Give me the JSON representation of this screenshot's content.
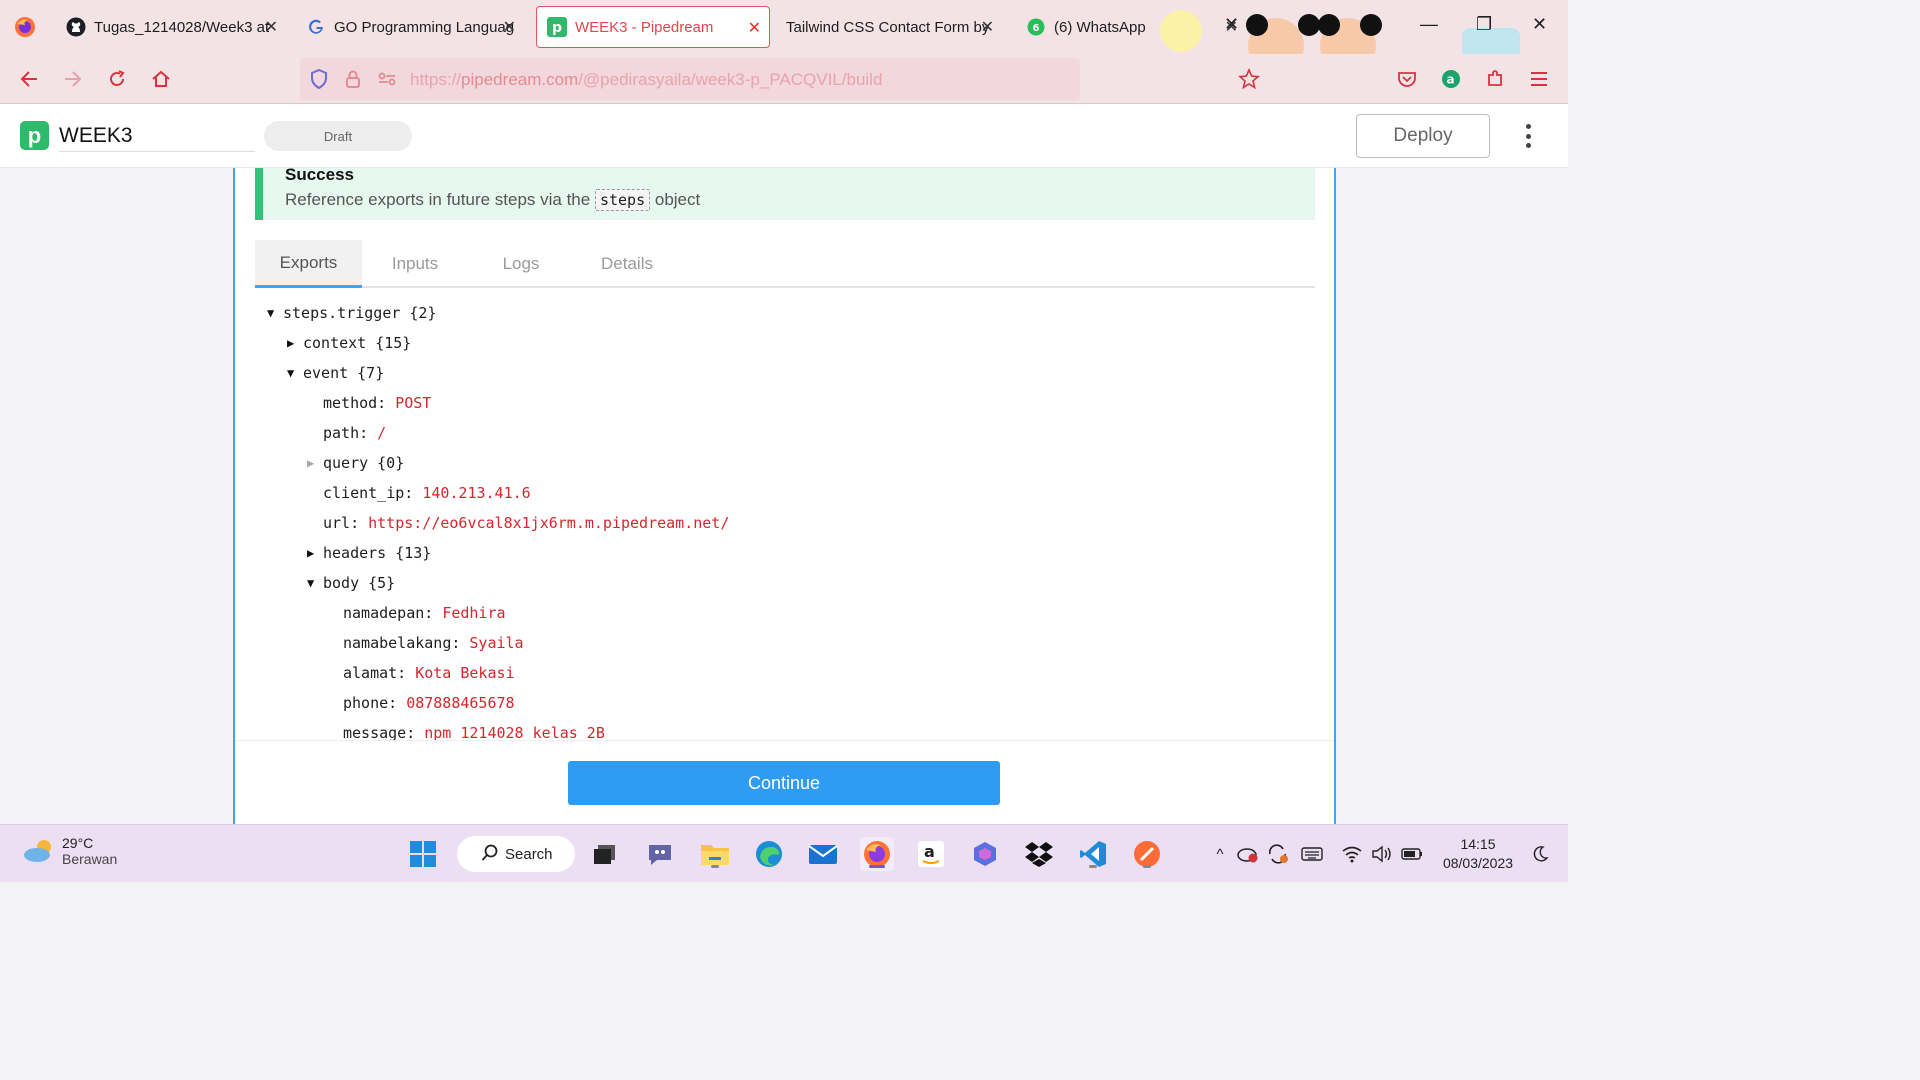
{
  "browser": {
    "tabs": [
      {
        "title": "Tugas_1214028/Week3 at",
        "icon": "github-icon"
      },
      {
        "title": "GO Programming Languag",
        "icon": "google-docs-icon"
      },
      {
        "title": "WEEK3 - Pipedream",
        "icon": "pipedream-icon",
        "active": true
      },
      {
        "title": "Tailwind CSS Contact Form by",
        "icon": "none"
      },
      {
        "title": "(6) WhatsApp",
        "icon": "whatsapp-icon",
        "badge": "6"
      }
    ],
    "url_prefix": "https://",
    "url_host": "pipedream.com",
    "url_path": "/@pedirasyaila/week3-p_PACQVIL/build"
  },
  "app": {
    "logo_letter": "p",
    "workflow_name": "WEEK3",
    "status": "Draft",
    "deploy_label": "Deploy"
  },
  "success": {
    "title": "Success",
    "desc_before": "Reference exports in future steps via the",
    "code": "steps",
    "desc_after": "object"
  },
  "panel_tabs": [
    "Exports",
    "Inputs",
    "Logs",
    "Details"
  ],
  "tree": {
    "root_key": "steps.trigger",
    "root_count": "{2}",
    "context_key": "context",
    "context_count": "{15}",
    "event_key": "event",
    "event_count": "{7}",
    "method_key": "method:",
    "method_val": "POST",
    "path_key": "path:",
    "path_val": "/",
    "query_key": "query",
    "query_count": "{0}",
    "client_ip_key": "client_ip:",
    "client_ip_val": "140.213.41.6",
    "url_key": "url:",
    "url_val": "https://eo6vcal8x1jx6rm.m.pipedream.net/",
    "headers_key": "headers",
    "headers_count": "{13}",
    "body_key": "body",
    "body_count": "{5}",
    "namadepan_key": "namadepan:",
    "namadepan_val": "Fedhira",
    "namabelakang_key": "namabelakang:",
    "namabelakang_val": "Syaila",
    "alamat_key": "alamat:",
    "alamat_val": "Kota Bekasi",
    "phone_key": "phone:",
    "phone_val": "087888465678",
    "message_key": "message:",
    "message_val": "npm 1214028 kelas 2B"
  },
  "continue_label": "Continue",
  "taskbar": {
    "weather_temp": "29°C",
    "weather_cond": "Berawan",
    "search_label": "Search",
    "time": "14:15",
    "date": "08/03/2023"
  },
  "colors": {
    "accent": "#3ea2f5",
    "pipedream_green": "#2fb96a",
    "success_bg": "#e6f8ef",
    "value_red": "#d6262b",
    "browser_chrome": "#f4e3e6"
  }
}
